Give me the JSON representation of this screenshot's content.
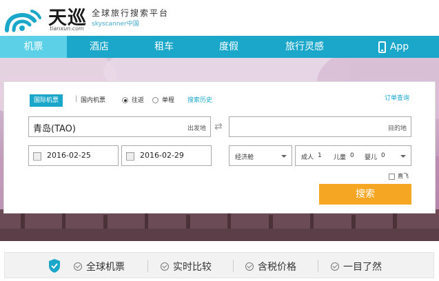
{
  "header": {
    "logo_text": "天巡",
    "logo_domain": "tianxun.com",
    "slogan": "全球旅行搜索平台",
    "sub_slogan": "skyscanner中国",
    "brand_color": "#1aa7c9"
  },
  "nav": {
    "items": [
      {
        "label": "机票",
        "active": true
      },
      {
        "label": "酒店",
        "active": false
      },
      {
        "label": "租车",
        "active": false
      },
      {
        "label": "度假",
        "active": false
      },
      {
        "label": "旅行灵感",
        "active": false
      },
      {
        "label": "App",
        "active": false,
        "icon": "phone-icon"
      }
    ]
  },
  "search": {
    "tab_international": "国际机票",
    "tab_domestic": "国内机票",
    "trip_roundtrip": "往返",
    "trip_oneway": "单程",
    "history": "搜索历史",
    "orders": "订单查询",
    "origin_value": "青岛(TAO)",
    "origin_hint": "出发地",
    "dest_value": "",
    "dest_hint": "目的地",
    "depart_date": "2016-02-25",
    "return_date": "2016-02-29",
    "cabin": "经济舱",
    "adults_label": "成人",
    "adults": "1",
    "children_label": "儿童",
    "children": "0",
    "infants_label": "婴儿",
    "infants": "0",
    "direct_label": "直飞",
    "search_button": "搜索",
    "button_color": "#f5a623"
  },
  "features": {
    "items": [
      "全球机票",
      "实时比较",
      "含税价格",
      "一目了然"
    ]
  }
}
